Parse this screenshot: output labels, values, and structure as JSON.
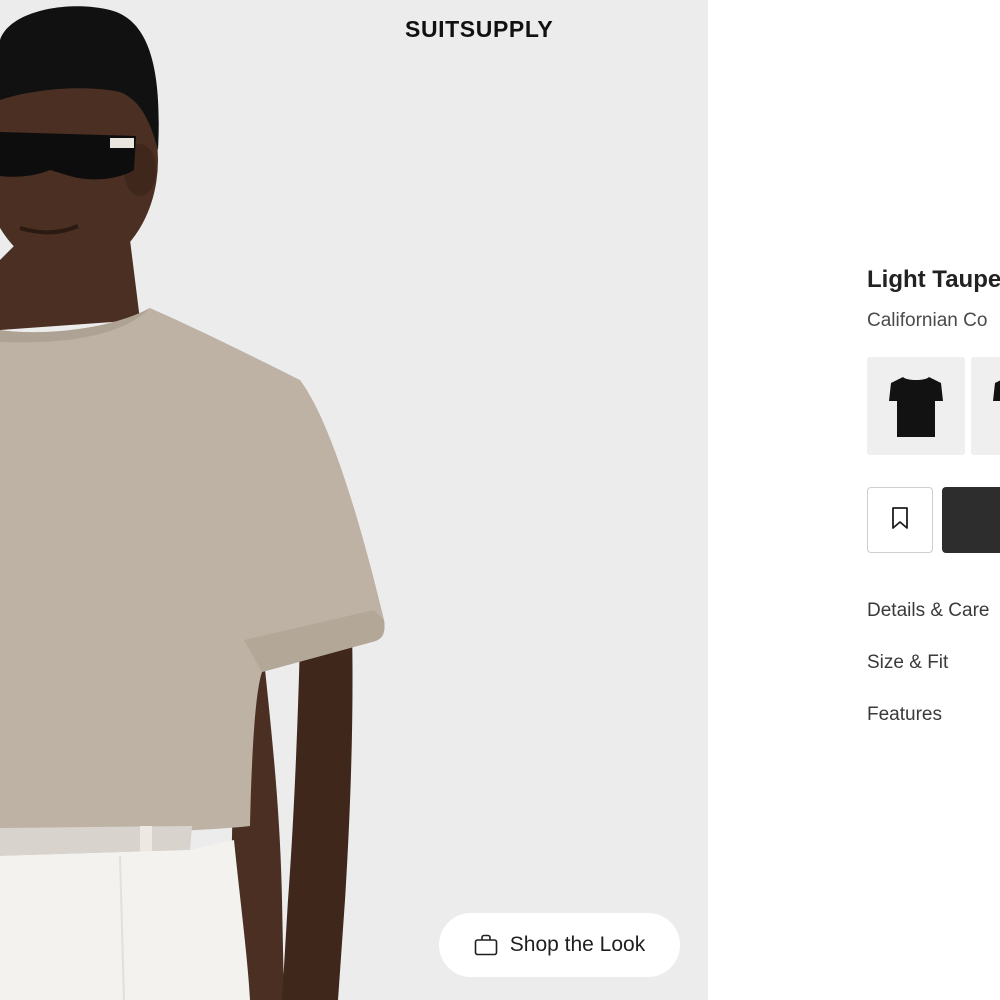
{
  "brand": {
    "logo_text": "SUITSUPPLY"
  },
  "gallery": {
    "shop_the_look": {
      "label": "Shop the Look",
      "icon": "shopping-bag-icon"
    }
  },
  "product": {
    "title": "Light Taupe",
    "subtitle": "Californian Co",
    "swatches": [
      {
        "name": "black-tshirt",
        "color": "#121212"
      },
      {
        "name": "second-swatch",
        "color": "#121212"
      }
    ]
  },
  "actions": {
    "bookmark_icon": "bookmark-icon",
    "add_button_color": "#2d2d2d"
  },
  "accordion": [
    {
      "label": "Details & Care"
    },
    {
      "label": "Size & Fit"
    },
    {
      "label": "Features"
    }
  ],
  "colors": {
    "gallery_bg": "#ececec",
    "tshirt": "#bdb2a4",
    "skin": "#4a2f22",
    "trousers": "#f3f2ef"
  }
}
